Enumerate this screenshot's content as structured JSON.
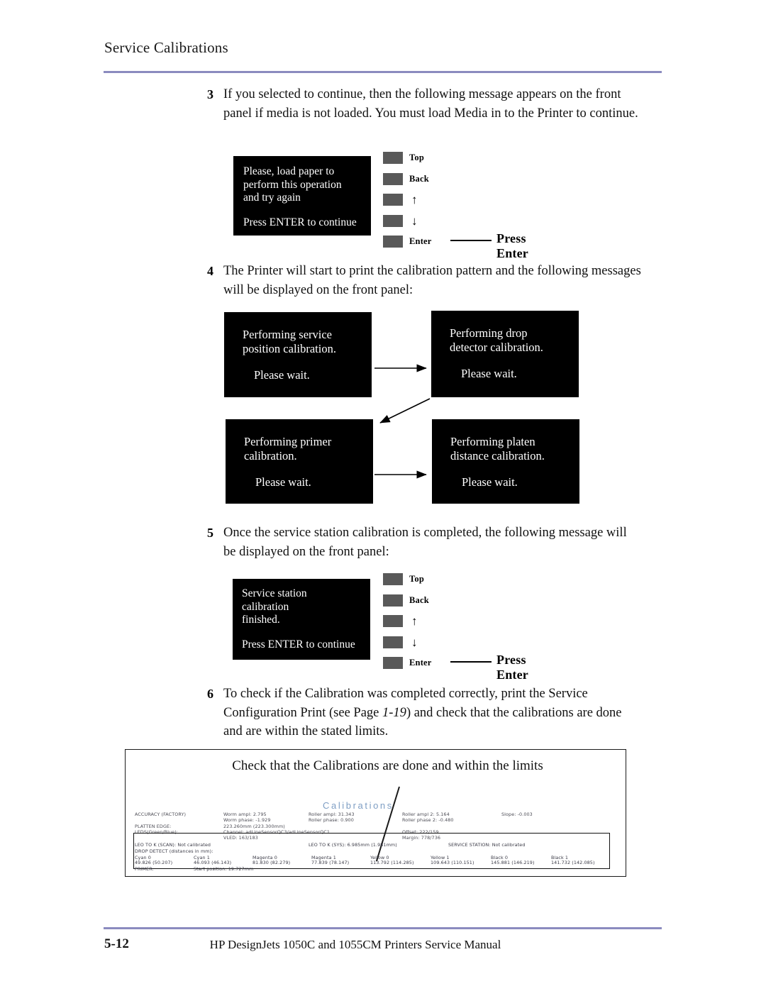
{
  "header": {
    "section_title": "Service Calibrations"
  },
  "footer": {
    "page_number": "5-12",
    "manual_title": "HP DesignJets 1050C and 1055CM Printers Service Manual"
  },
  "steps": {
    "step3": {
      "number": "3",
      "text": "If you selected to continue, then the following message appears on the front panel if media is not loaded. You must load Media in to the Printer to continue."
    },
    "step4": {
      "number": "4",
      "text": "The Printer will start to print the calibration pattern and the following messages will be displayed on the front panel:"
    },
    "step5": {
      "number": "5",
      "text": "Once the service station calibration is completed, the following message will be displayed on the front panel:"
    },
    "step6": {
      "number": "6",
      "text_part1": "To check if the Calibration was completed correctly, print the Service Configuration Print (see Page ",
      "page_ref": "1-19",
      "text_part2": ") and check that the calibrations are done and are within the stated limits."
    }
  },
  "panels": {
    "media_prompt": {
      "line1": "Please, load paper to",
      "line2": "perform this operation",
      "line3": "and try again",
      "line4": "Press ENTER to continue"
    },
    "finished": {
      "line1": "Service station",
      "line2": "calibration",
      "line3": "finished.",
      "line4": "Press ENTER to continue"
    },
    "flow": [
      {
        "id": "service-position",
        "line1": "Performing service",
        "line2": "position calibration.",
        "wait": "Please wait."
      },
      {
        "id": "drop-detector",
        "line1": "Performing drop",
        "line2": "detector calibration.",
        "wait": "Please wait."
      },
      {
        "id": "primer",
        "line1": "Performing primer",
        "line2": "calibration.",
        "wait": "Please wait."
      },
      {
        "id": "platen-distance",
        "line1": "Performing platen",
        "line2": "distance calibration.",
        "wait": "Please wait."
      }
    ]
  },
  "front_panel_keys": {
    "keys": [
      {
        "name": "top",
        "label": "Top"
      },
      {
        "name": "back",
        "label": "Back"
      },
      {
        "name": "up",
        "label": "↑"
      },
      {
        "name": "down",
        "label": "↓"
      },
      {
        "name": "enter",
        "label": "Enter"
      }
    ],
    "callout": "Press Enter",
    "button_color": "#595959"
  },
  "printout": {
    "caption": "Check that the Calibrations are done and within the limits",
    "title": "Calibrations",
    "title_color": "#7e9ec4",
    "rows": [
      {
        "c1": "ACCURACY (FACTORY)",
        "c2": "Worm ampl: 2.795",
        "c3": "Roller ampl: 31.343",
        "c4": "Roller ampl 2: 5.164",
        "c5": "Slope: -0.003"
      },
      {
        "c1": "",
        "c2": "Worm phase: -1.929",
        "c3": "Roller phase: 0.900",
        "c4": "Roller phase 2: -0.480",
        "c5": ""
      },
      {
        "c1": "PLATTEN EDGE:",
        "c2": "223.260mm (223.300mm)",
        "c3": "",
        "c4": "",
        "c5": ""
      },
      {
        "c1": "LEDS(Green/Blue):",
        "c2": "Channel: adLineSensorQC3/adLineSensorQC1",
        "c3": "",
        "c4": "Offset: 222/159",
        "c5": ""
      },
      {
        "c1": "",
        "c2": "VLED: 163/183",
        "c3": "",
        "c4": "Margin: 778/736",
        "c5": ""
      }
    ],
    "inner_rows": [
      {
        "c1": "LEO TO K (SCAN): Not calibrated",
        "c2": "",
        "c3": "LEO TO K (SYS): 6.985mm (1.981mm)",
        "c4": "SERVICE STATION: Not calibrated",
        "c5": ""
      },
      {
        "c1": "DROP DETECT (distances in mm):",
        "c2": "",
        "c3": "",
        "c4": "",
        "c5": ""
      }
    ],
    "drop_detect_headers": [
      "Cyan 0",
      "Cyan 1",
      "Magenta 0",
      "Magenta 1",
      "Yellow 0",
      "Yellow 1",
      "Black 0",
      "Black 1"
    ],
    "drop_detect_values": [
      "49.826 (50.207)",
      "46.093 (46.143)",
      "81.830 (82.279)",
      "77.839 (78.147)",
      "113.792 (114.285)",
      "109.643 (110.151)",
      "145.881 (146.219)",
      "141.732 (142.085)"
    ],
    "primer_row": {
      "label": "PRIMER:",
      "value": "Start position: 19.727mm"
    }
  }
}
